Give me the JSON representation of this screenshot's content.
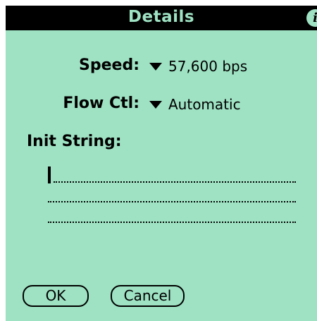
{
  "dialog": {
    "title": "Details",
    "info_icon": "info-icon"
  },
  "speed": {
    "label": "Speed:",
    "value": "57,600 bps"
  },
  "flow_control": {
    "label": "Flow Ctl:",
    "value": "Automatic"
  },
  "init_string": {
    "label": "Init String:",
    "value": ""
  },
  "buttons": {
    "ok": "OK",
    "cancel": "Cancel"
  },
  "colors": {
    "background": "#9ee2c3",
    "titlebar": "#000000",
    "text": "#000000"
  }
}
